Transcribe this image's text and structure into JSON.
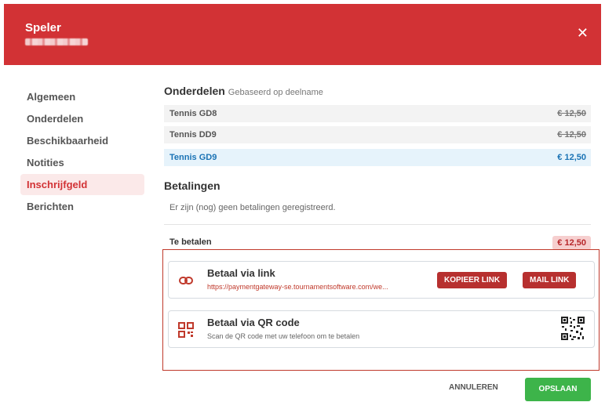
{
  "header": {
    "title": "Speler",
    "close_icon": "close-icon"
  },
  "sidebar": {
    "items": [
      {
        "label": "Algemeen"
      },
      {
        "label": "Onderdelen"
      },
      {
        "label": "Beschikbaarheid"
      },
      {
        "label": "Notities"
      },
      {
        "label": "Inschrijfgeld",
        "active": true
      },
      {
        "label": "Berichten"
      }
    ]
  },
  "onderdelen": {
    "title": "Onderdelen",
    "subtitle": "Gebaseerd op deelname",
    "rows": [
      {
        "name": "Tennis GD8",
        "price": "€ 12,50",
        "struck": true
      },
      {
        "name": "Tennis DD9",
        "price": "€ 12,50",
        "struck": true
      },
      {
        "name": "Tennis GD9",
        "price": "€ 12,50",
        "active": true
      }
    ]
  },
  "betalingen": {
    "title": "Betalingen",
    "empty": "Er zijn (nog) geen betalingen geregistreerd.",
    "to_pay_label": "Te betalen",
    "to_pay_amount": "€ 12,50"
  },
  "pay_link": {
    "title": "Betaal via link",
    "url": "https://paymentgateway-se.tournamentsoftware.com/we...",
    "copy_label": "KOPIEER LINK",
    "mail_label": "MAIL LINK",
    "icon": "link-icon"
  },
  "pay_qr": {
    "title": "Betaal via QR code",
    "subtitle": "Scan de QR code met uw telefoon om te betalen",
    "icon": "qr-icon"
  },
  "footer": {
    "cancel_label": "ANNULEREN",
    "save_label": "OPSLAAN"
  },
  "colors": {
    "accent": "#d23235",
    "active_blue": "#1a73b5",
    "save_green": "#3db44a"
  }
}
